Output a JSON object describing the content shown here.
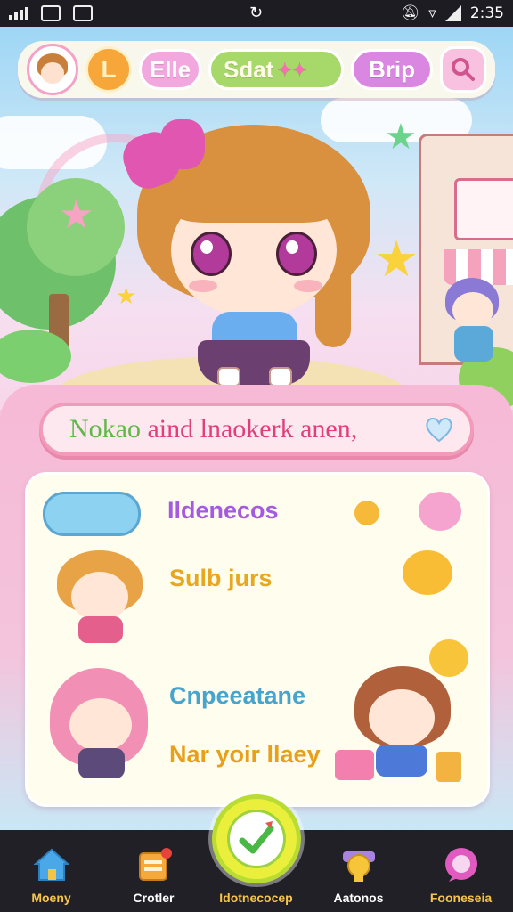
{
  "status_bar": {
    "time": "2:35"
  },
  "top_bar": {
    "coin_label": "L",
    "elle_label": "Elle",
    "start_label": "Sdat",
    "brip_label": "Brip"
  },
  "banner": {
    "text_part1": "Nokao",
    "text_part2": "aind lnaokerk anen,"
  },
  "list": {
    "items": [
      {
        "label": "Ildenecos"
      },
      {
        "label": "Sulb jurs"
      },
      {
        "label": "Cnpeeatane"
      },
      {
        "label": "Nar yoir llaey"
      }
    ]
  },
  "bottom_nav": {
    "items": [
      {
        "label": "Moeny"
      },
      {
        "label": "Crotler"
      },
      {
        "label": "Idotnecocep"
      },
      {
        "label": "Aatonos"
      },
      {
        "label": "Fooneseia"
      }
    ]
  },
  "colors": {
    "accent_pink": "#f29ab9",
    "accent_gold": "#f6c54c",
    "nav_bg": "#222027"
  },
  "icons": {
    "search": "search-icon",
    "home": "home-icon",
    "check": "checkmark-icon",
    "heart": "heart-icon"
  }
}
